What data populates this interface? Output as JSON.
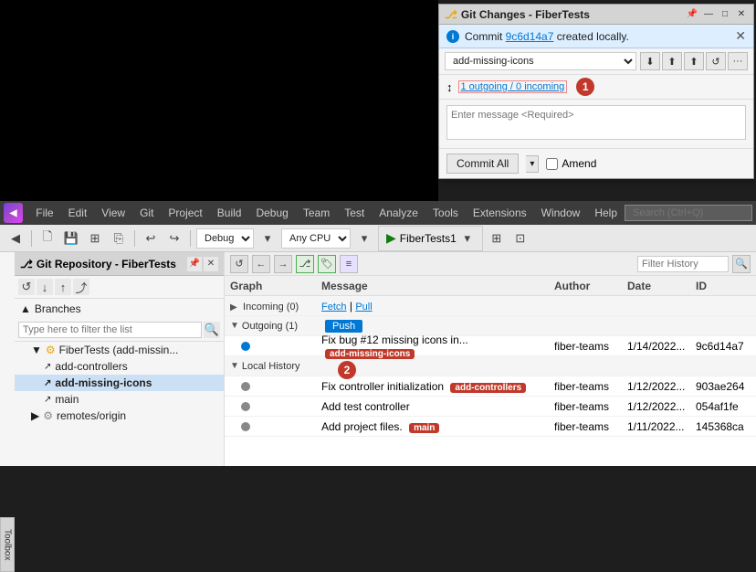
{
  "panel": {
    "title": "Git Changes - FiberTests",
    "info_message": "Commit ",
    "commit_hash": "9c6d14a7",
    "info_suffix": " created locally.",
    "close_label": "✕",
    "pin_label": "📌",
    "minimize_label": "—",
    "maximize_label": "□",
    "branch_name": "add-missing-icons",
    "sync_icon": "↕",
    "fetch_down_label": "⬇",
    "fetch_up_label": "⬆",
    "sync_label": "↺",
    "more_label": "···",
    "outgoing_text": "1 outgoing / 0 incoming",
    "message_placeholder": "Enter message <Required>",
    "commit_label": "Commit All",
    "dropdown_label": "▾",
    "amend_label": "Amend"
  },
  "menubar": {
    "items": [
      "File",
      "Edit",
      "View",
      "Git",
      "Project",
      "Build",
      "Debug",
      "Team",
      "Test",
      "Analyze",
      "Tools",
      "Extensions",
      "Window",
      "Help"
    ],
    "search_placeholder": "Search (Ctrl+Q)"
  },
  "toolbar": {
    "debug_config": "Debug",
    "platform": "Any CPU",
    "run_target": "FiberTests1"
  },
  "sidebar": {
    "title": "Git Repository - FiberTests",
    "sections_label": "Branches",
    "filter_placeholder": "Type here to filter the list",
    "items": [
      {
        "label": "FiberTests (add-missin...",
        "indent": 1,
        "type": "repo"
      },
      {
        "label": "add-controllers",
        "indent": 2,
        "type": "branch"
      },
      {
        "label": "add-missing-icons",
        "indent": 2,
        "type": "branch",
        "active": true
      },
      {
        "label": "main",
        "indent": 2,
        "type": "branch"
      },
      {
        "label": "remotes/origin",
        "indent": 1,
        "type": "remote"
      }
    ]
  },
  "graph": {
    "filter_placeholder": "Filter History",
    "columns": [
      "Graph",
      "Message",
      "Author",
      "Date",
      "ID"
    ],
    "rows": [
      {
        "type": "section",
        "label": "Incoming (0)",
        "links": "Fetch | Pull",
        "expanded": false
      },
      {
        "type": "section",
        "label": "Outgoing (1)",
        "expanded": true,
        "has_push": true,
        "push_label": "Push"
      },
      {
        "type": "data",
        "message": "Fix bug #12 missing icons in...",
        "tag": "add-missing-icons",
        "tag_class": "tag-add-missing",
        "author": "fiber-teams",
        "date": "1/14/2022...",
        "id": "9c6d14a7",
        "dot_class": "dot-blue"
      },
      {
        "type": "section",
        "label": "Local History",
        "expanded": true
      },
      {
        "type": "data",
        "message": "Fix controller initialization",
        "tag": "add-controllers",
        "tag_class": "tag-add-controllers",
        "author": "fiber-teams",
        "date": "1/12/2022...",
        "id": "903ae264",
        "dot_class": "dot-gray"
      },
      {
        "type": "data",
        "message": "Add test controller",
        "tag": "",
        "tag_class": "",
        "author": "fiber-teams",
        "date": "1/12/2022...",
        "id": "054af1fe",
        "dot_class": "dot-gray"
      },
      {
        "type": "data",
        "message": "Add project files.",
        "tag": "main",
        "tag_class": "tag-main",
        "author": "fiber-teams",
        "date": "1/11/2022...",
        "id": "145368ca",
        "dot_class": "dot-gray"
      }
    ]
  },
  "badges": {
    "circle1": "1",
    "circle2": "2"
  }
}
